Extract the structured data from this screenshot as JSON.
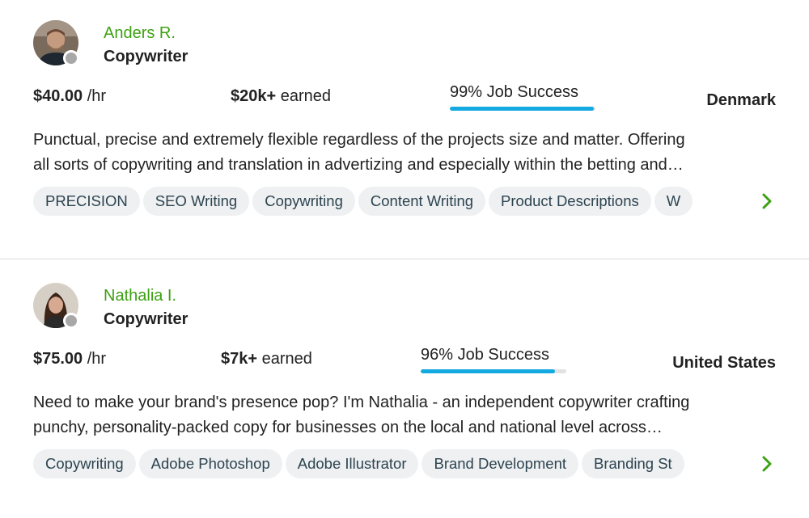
{
  "colors": {
    "name_green": "#3da114",
    "progress_blue": "#14a9e0",
    "chip_bg": "#eef0f2",
    "status_dot": "#a8a8a8"
  },
  "freelancers": [
    {
      "name": "Anders R.",
      "title": "Copywriter",
      "rate_amount": "$40.00",
      "rate_unit": "/hr",
      "earned_amount": "$20k+",
      "earned_label": "earned",
      "job_success": "99% Job Success",
      "job_success_pct": 99,
      "location": "Denmark",
      "description_line1": "Punctual, precise and extremely flexible regardless of the projects size and matter. Offering",
      "description_line2": "all sorts of copywriting and translation in advertizing and especially within the betting and…",
      "skills": [
        "PRECISION",
        "SEO Writing",
        "Copywriting",
        "Content Writing",
        "Product Descriptions",
        "W"
      ],
      "status": "offline",
      "avatar_icon": "user-photo-avatar"
    },
    {
      "name": "Nathalia I.",
      "title": "Copywriter",
      "rate_amount": "$75.00",
      "rate_unit": "/hr",
      "earned_amount": "$7k+",
      "earned_label": "earned",
      "job_success": "96% Job Success",
      "job_success_pct": 96,
      "location": "United States",
      "description_line1": "Need to make your brand's presence pop? I'm Nathalia - an independent copywriter crafting",
      "description_line2": "punchy, personality-packed copy for businesses on the local and national level across…",
      "skills": [
        "Copywriting",
        "Adobe Photoshop",
        "Adobe Illustrator",
        "Brand Development",
        "Branding St"
      ],
      "status": "offline",
      "avatar_icon": "user-photo-avatar"
    }
  ],
  "icons": {
    "skills_next": "chevron-right-icon"
  }
}
